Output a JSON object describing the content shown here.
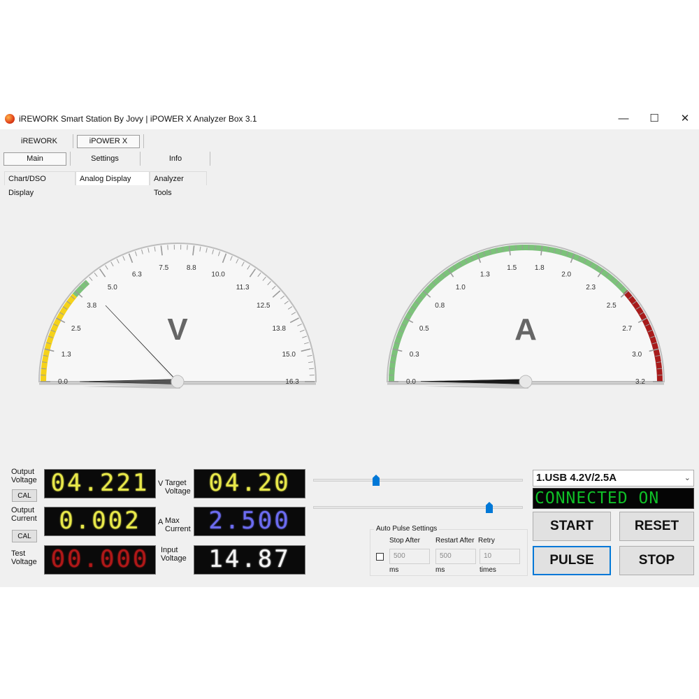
{
  "title": "iREWORK Smart Station By Jovy | iPOWER X Analyzer Box 3.1",
  "window_controls": {
    "minimize": "—",
    "maximize": "☐",
    "close": "✕"
  },
  "tabs_top": [
    "iREWORK",
    "iPOWER X"
  ],
  "tabs_second": [
    "Main",
    "Settings",
    "Info"
  ],
  "tabs_third": [
    "Chart/DSO Display",
    "Analog Display",
    "Analyzer Tools"
  ],
  "gauge_v": {
    "unit": "V",
    "ticks": [
      "0.0",
      "1.3",
      "2.5",
      "3.8",
      "5.0",
      "6.3",
      "7.5",
      "8.8",
      "10.0",
      "11.3",
      "12.5",
      "13.8",
      "15.0",
      "16.3"
    ],
    "max": 16.3,
    "needle_value": 4.221,
    "target_value": 0.0
  },
  "gauge_a": {
    "unit": "A",
    "ticks": [
      "0.0",
      "0.3",
      "0.5",
      "0.8",
      "1.0",
      "1.3",
      "1.5",
      "1.8",
      "2.0",
      "2.3",
      "2.5",
      "2.7",
      "3.0",
      "3.2"
    ],
    "max": 3.2,
    "needle_value": 0.002
  },
  "labels": {
    "output_voltage": "Output\nVoltage",
    "output_current": "Output\nCurrent",
    "test_voltage": "Test\nVoltage",
    "target_voltage": "Target\nVoltage",
    "max_current": "Max\nCurrent",
    "input_voltage": "Input\nVoltage",
    "unit_v": "V",
    "unit_a": "A",
    "cal": "CAL"
  },
  "displays": {
    "output_voltage": "04.221",
    "output_current": "0.002",
    "test_voltage": "00.000",
    "target_voltage": "04.20",
    "max_current": "2.500",
    "input_voltage": "14.87"
  },
  "colors": {
    "output_voltage": "#e8e84a",
    "output_current": "#e8e84a",
    "test_voltage": "#b01818",
    "target_voltage": "#e8e84a",
    "max_current": "#6c6cf0",
    "input_voltage": "#f4f4f4",
    "gauge_green": "#7cc27a",
    "gauge_yellow": "#f5d21a",
    "gauge_red": "#a81c1c",
    "accent": "#0078d7"
  },
  "sliders": {
    "voltage_level": 0.3,
    "current_level": 0.84
  },
  "auto_pulse": {
    "title": "Auto Pulse Settings",
    "stop_after_label": "Stop After",
    "restart_label": "Restart After",
    "retry_label": "Retry",
    "stop_after_value": "500",
    "restart_value": "500",
    "retry_value": "10",
    "unit_ms": "ms",
    "unit_times": "times"
  },
  "profile_select": "1.USB 4.2V/2.5A",
  "status": "CONNECTED ON",
  "buttons": {
    "start": "START",
    "reset": "RESET",
    "pulse": "PULSE",
    "stop": "STOP"
  }
}
